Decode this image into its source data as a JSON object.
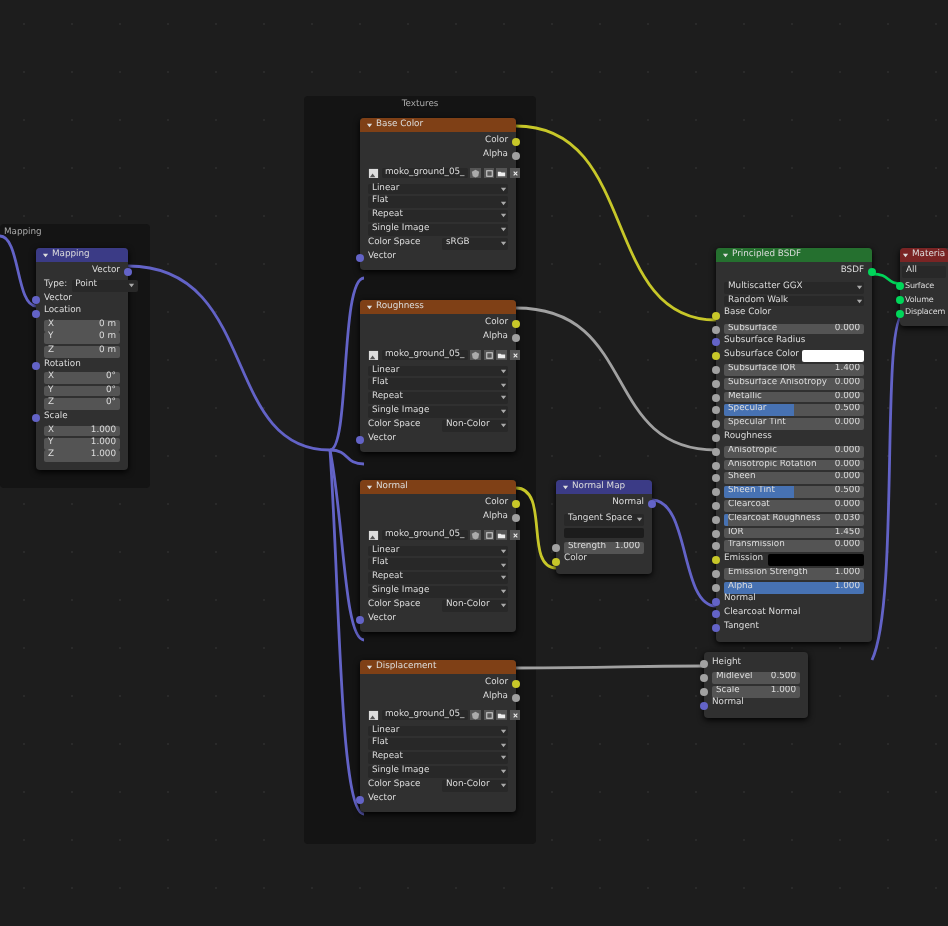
{
  "frames": [
    {
      "label": "Mapping"
    },
    {
      "label": "Textures"
    }
  ],
  "mapping": {
    "title": "Mapping",
    "output": "Vector",
    "type_label": "Type:",
    "type_value": "Point",
    "input": "Vector",
    "groups": [
      {
        "label": "Location",
        "fields": [
          {
            "axis": "X",
            "value": "0 m"
          },
          {
            "axis": "Y",
            "value": "0 m"
          },
          {
            "axis": "Z",
            "value": "0 m"
          }
        ]
      },
      {
        "label": "Rotation",
        "fields": [
          {
            "axis": "X",
            "value": "0°"
          },
          {
            "axis": "Y",
            "value": "0°"
          },
          {
            "axis": "Z",
            "value": "0°"
          }
        ]
      },
      {
        "label": "Scale",
        "fields": [
          {
            "axis": "X",
            "value": "1.000"
          },
          {
            "axis": "Y",
            "value": "1.000"
          },
          {
            "axis": "Z",
            "value": "1.000"
          }
        ]
      }
    ]
  },
  "textures": [
    {
      "title": "Base Color",
      "outputs": [
        {
          "label": "Color",
          "color": "#c7c729"
        },
        {
          "label": "Alpha",
          "color": "#a1a1a1"
        }
      ],
      "image": "moko_ground_05_",
      "options": [
        "Linear",
        "Flat",
        "Repeat",
        "Single Image"
      ],
      "color_space_label": "Color Space",
      "color_space": "sRGB",
      "input": "Vector"
    },
    {
      "title": "Roughness",
      "outputs": [
        {
          "label": "Color",
          "color": "#c7c729"
        },
        {
          "label": "Alpha",
          "color": "#a1a1a1"
        }
      ],
      "image": "moko_ground_05_",
      "options": [
        "Linear",
        "Flat",
        "Repeat",
        "Single Image"
      ],
      "color_space_label": "Color Space",
      "color_space": "Non-Color",
      "input": "Vector"
    },
    {
      "title": "Normal",
      "outputs": [
        {
          "label": "Color",
          "color": "#c7c729"
        },
        {
          "label": "Alpha",
          "color": "#a1a1a1"
        }
      ],
      "image": "moko_ground_05_",
      "options": [
        "Linear",
        "Flat",
        "Repeat",
        "Single Image"
      ],
      "color_space_label": "Color Space",
      "color_space": "Non-Color",
      "input": "Vector"
    },
    {
      "title": "Displacement",
      "outputs": [
        {
          "label": "Color",
          "color": "#c7c729"
        },
        {
          "label": "Alpha",
          "color": "#a1a1a1"
        }
      ],
      "image": "moko_ground_05_",
      "options": [
        "Linear",
        "Flat",
        "Repeat",
        "Single Image"
      ],
      "color_space_label": "Color Space",
      "color_space": "Non-Color",
      "input": "Vector"
    }
  ],
  "normal_map": {
    "title": "Normal Map",
    "output": "Normal",
    "space": "Tangent Space",
    "strength_label": "Strength",
    "strength": "1.000",
    "input": "Color"
  },
  "bsdf": {
    "title": "Principled BSDF",
    "output": "BSDF",
    "distribution": "Multiscatter GGX",
    "subsurface_method": "Random Walk",
    "inputs": [
      {
        "kind": "label",
        "label": "Base Color",
        "color": "#c7c729"
      },
      {
        "kind": "field",
        "label": "Subsurface",
        "value": "0.000",
        "color": "#a1a1a1"
      },
      {
        "kind": "label",
        "label": "Subsurface Radius",
        "color": "#6363c7"
      },
      {
        "kind": "swatch",
        "label": "Subsurface Color",
        "swatch": {
          "color": "#ffffff"
        },
        "color": "#c7c729"
      },
      {
        "kind": "field",
        "label": "Subsurface IOR",
        "value": "1.400",
        "color": "#a1a1a1"
      },
      {
        "kind": "field",
        "label": "Subsurface Anisotropy",
        "value": "0.000",
        "color": "#a1a1a1"
      },
      {
        "kind": "field",
        "label": "Metallic",
        "value": "0.000",
        "color": "#a1a1a1"
      },
      {
        "kind": "slider",
        "label": "Specular",
        "value": "0.500",
        "level": 0.5,
        "color": "#a1a1a1"
      },
      {
        "kind": "field",
        "label": "Specular Tint",
        "value": "0.000",
        "color": "#a1a1a1"
      },
      {
        "kind": "label",
        "label": "Roughness",
        "color": "#a1a1a1"
      },
      {
        "kind": "field",
        "label": "Anisotropic",
        "value": "0.000",
        "color": "#a1a1a1"
      },
      {
        "kind": "field",
        "label": "Anisotropic Rotation",
        "value": "0.000",
        "color": "#a1a1a1"
      },
      {
        "kind": "field",
        "label": "Sheen",
        "value": "0.000",
        "color": "#a1a1a1"
      },
      {
        "kind": "slider",
        "label": "Sheen Tint",
        "value": "0.500",
        "level": 0.5,
        "color": "#a1a1a1"
      },
      {
        "kind": "field",
        "label": "Clearcoat",
        "value": "0.000",
        "color": "#a1a1a1"
      },
      {
        "kind": "slider",
        "label": "Clearcoat Roughness",
        "value": "0.030",
        "level": 0.03,
        "color": "#a1a1a1"
      },
      {
        "kind": "field",
        "label": "IOR",
        "value": "1.450",
        "color": "#a1a1a1"
      },
      {
        "kind": "field",
        "label": "Transmission",
        "value": "0.000",
        "color": "#a1a1a1"
      },
      {
        "kind": "swatch",
        "label": "Emission",
        "swatch": {
          "color": "#000000"
        },
        "color": "#c7c729"
      },
      {
        "kind": "field",
        "label": "Emission Strength",
        "value": "1.000",
        "color": "#a1a1a1"
      },
      {
        "kind": "slider",
        "label": "Alpha",
        "value": "1.000",
        "level": 1,
        "color": "#a1a1a1"
      },
      {
        "kind": "label",
        "label": "Normal",
        "color": "#6363c7"
      },
      {
        "kind": "label",
        "label": "Clearcoat Normal",
        "color": "#6363c7"
      },
      {
        "kind": "label",
        "label": "Tangent",
        "color": "#6363c7"
      }
    ]
  },
  "displacement": {
    "inputs": [
      {
        "kind": "label",
        "label": "Height",
        "color": "#a1a1a1"
      },
      {
        "kind": "field",
        "label": "Midlevel",
        "value": "0.500",
        "color": "#a1a1a1"
      },
      {
        "kind": "field",
        "label": "Scale",
        "value": "1.000",
        "color": "#a1a1a1"
      },
      {
        "kind": "label",
        "label": "Normal",
        "color": "#6363c7"
      }
    ]
  },
  "material_output": {
    "title": "Materia",
    "inputs": [
      {
        "label": "All",
        "kind": "dropdown"
      },
      {
        "label": "Surface",
        "kind": "socket"
      },
      {
        "label": "Volume",
        "kind": "socket"
      },
      {
        "label": "Displacem",
        "kind": "socket"
      }
    ]
  }
}
